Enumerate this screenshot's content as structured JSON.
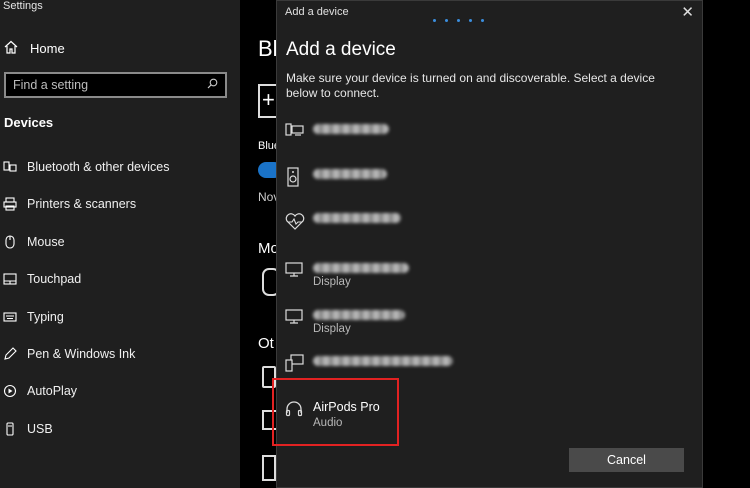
{
  "window": {
    "title": "Settings"
  },
  "sidebar": {
    "home_label": "Home",
    "search_placeholder": "Find a setting",
    "section_title": "Devices",
    "items": [
      {
        "label": "Bluetooth & other devices",
        "icon": "bluetooth-devices-icon"
      },
      {
        "label": "Printers & scanners",
        "icon": "printer-icon"
      },
      {
        "label": "Mouse",
        "icon": "mouse-icon"
      },
      {
        "label": "Touchpad",
        "icon": "touchpad-icon"
      },
      {
        "label": "Typing",
        "icon": "keyboard-icon"
      },
      {
        "label": "Pen & Windows Ink",
        "icon": "pen-icon"
      },
      {
        "label": "AutoPlay",
        "icon": "autoplay-icon"
      },
      {
        "label": "USB",
        "icon": "usb-icon"
      }
    ]
  },
  "main": {
    "title_partial": "Bl",
    "bluetooth_partial": "Blue",
    "now_partial": "Nov",
    "mouse_section_partial": "Mo",
    "other_section_partial": "Ot"
  },
  "dialog": {
    "titlebar": "Add a device",
    "heading": "Add a device",
    "description": "Make sure your device is turned on and discoverable. Select a device below to connect.",
    "devices": [
      {
        "icon": "computer-icon",
        "subtitle": ""
      },
      {
        "icon": "speaker-icon",
        "subtitle": ""
      },
      {
        "icon": "heart-rate-icon",
        "subtitle": ""
      },
      {
        "icon": "display-icon",
        "subtitle": "Display"
      },
      {
        "icon": "display-icon",
        "subtitle": "Display"
      },
      {
        "icon": "computer-phone-icon",
        "subtitle": ""
      }
    ],
    "highlighted_device": {
      "name": "AirPods Pro",
      "subtitle": "Audio",
      "icon": "headphones-icon"
    },
    "cancel_label": "Cancel"
  },
  "colors": {
    "accent": "#1a73c8",
    "highlight_border": "#e22222",
    "dialog_bg": "#1f1f1f"
  }
}
